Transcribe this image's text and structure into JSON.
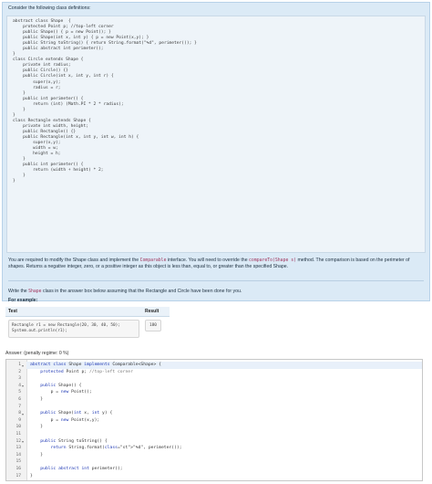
{
  "question": {
    "intro": "Consider the following class definitions:",
    "code_lines": [
      "abstract class Shape  {",
      "    protected Point p; //top-left corner",
      "    public Shape() { p = new Point(); }",
      "    public Shape(int x, int y) { p = new Point(x,y); }",
      "    public String toString() { return String.format(\"%d\", perimeter()); }",
      "    public abstract int perimeter();",
      "}",
      "class Circle extends Shape {",
      "    private int radius;",
      "    public Circle() {}",
      "    public Circle(int x, int y, int r) {",
      "        super(x,y);",
      "        radius = r;",
      "    }",
      "    public int perimeter() {",
      "        return (int) (Math.PI * 2 * radius);",
      "    }",
      "}",
      "class Rectangle extends Shape {",
      "    private int width, height;",
      "    public Rectangle() {}",
      "    public Rectangle(int x, int y, int w, int h) {",
      "        super(x,y);",
      "        width = w;",
      "        height = h;",
      "    }",
      "    public int perimeter() {",
      "        return (width + height) * 2;",
      "    }",
      "}"
    ],
    "para1_a": "You are required to modify the Shape class and implement the ",
    "para1_code1": "Comparable",
    "para1_b": " interface. You will need to override the ",
    "para1_code2": "compareTo(Shape s)",
    "para1_c": " method. The comparison is based on the perimeter of shapes. Returns a negative integer, zero, or a positive integer as this object is less than, equal to, or greater than the specified Shape.",
    "para2_a": "Write the ",
    "para2_code": "Shape",
    "para2_b": " class in the answer box below assuming that the Rectangle and Circle have been done for you.",
    "example_label": "For example:",
    "table_headers": [
      "Test",
      "Result"
    ],
    "test_code": "Rectangle r1 = new Rectangle(20, 30, 40, 50);\nSystem.out.println(r1);",
    "test_result": "180"
  },
  "answer": {
    "label": "Answer:  (penalty regime: 0 %)",
    "line_numbers": [
      "1",
      "2",
      "3",
      "4",
      "5",
      "6",
      "7",
      "8",
      "9",
      "10",
      "11",
      "12",
      "13",
      "14",
      "15",
      "16",
      "17"
    ],
    "lines": [
      "abstract class Shape implements Comparable<Shape> {",
      "    protected Point p; //top-left corner",
      "",
      "    public Shape() {",
      "        p = new Point();",
      "    }",
      "",
      "    public Shape(int x, int y) {",
      "        p = new Point(x,y);",
      "    }",
      "",
      "    public String toString() {",
      "        return String.format(\"%d\", perimeter());",
      "    }",
      "",
      "    public abstract int perimeter();",
      "}"
    ]
  }
}
